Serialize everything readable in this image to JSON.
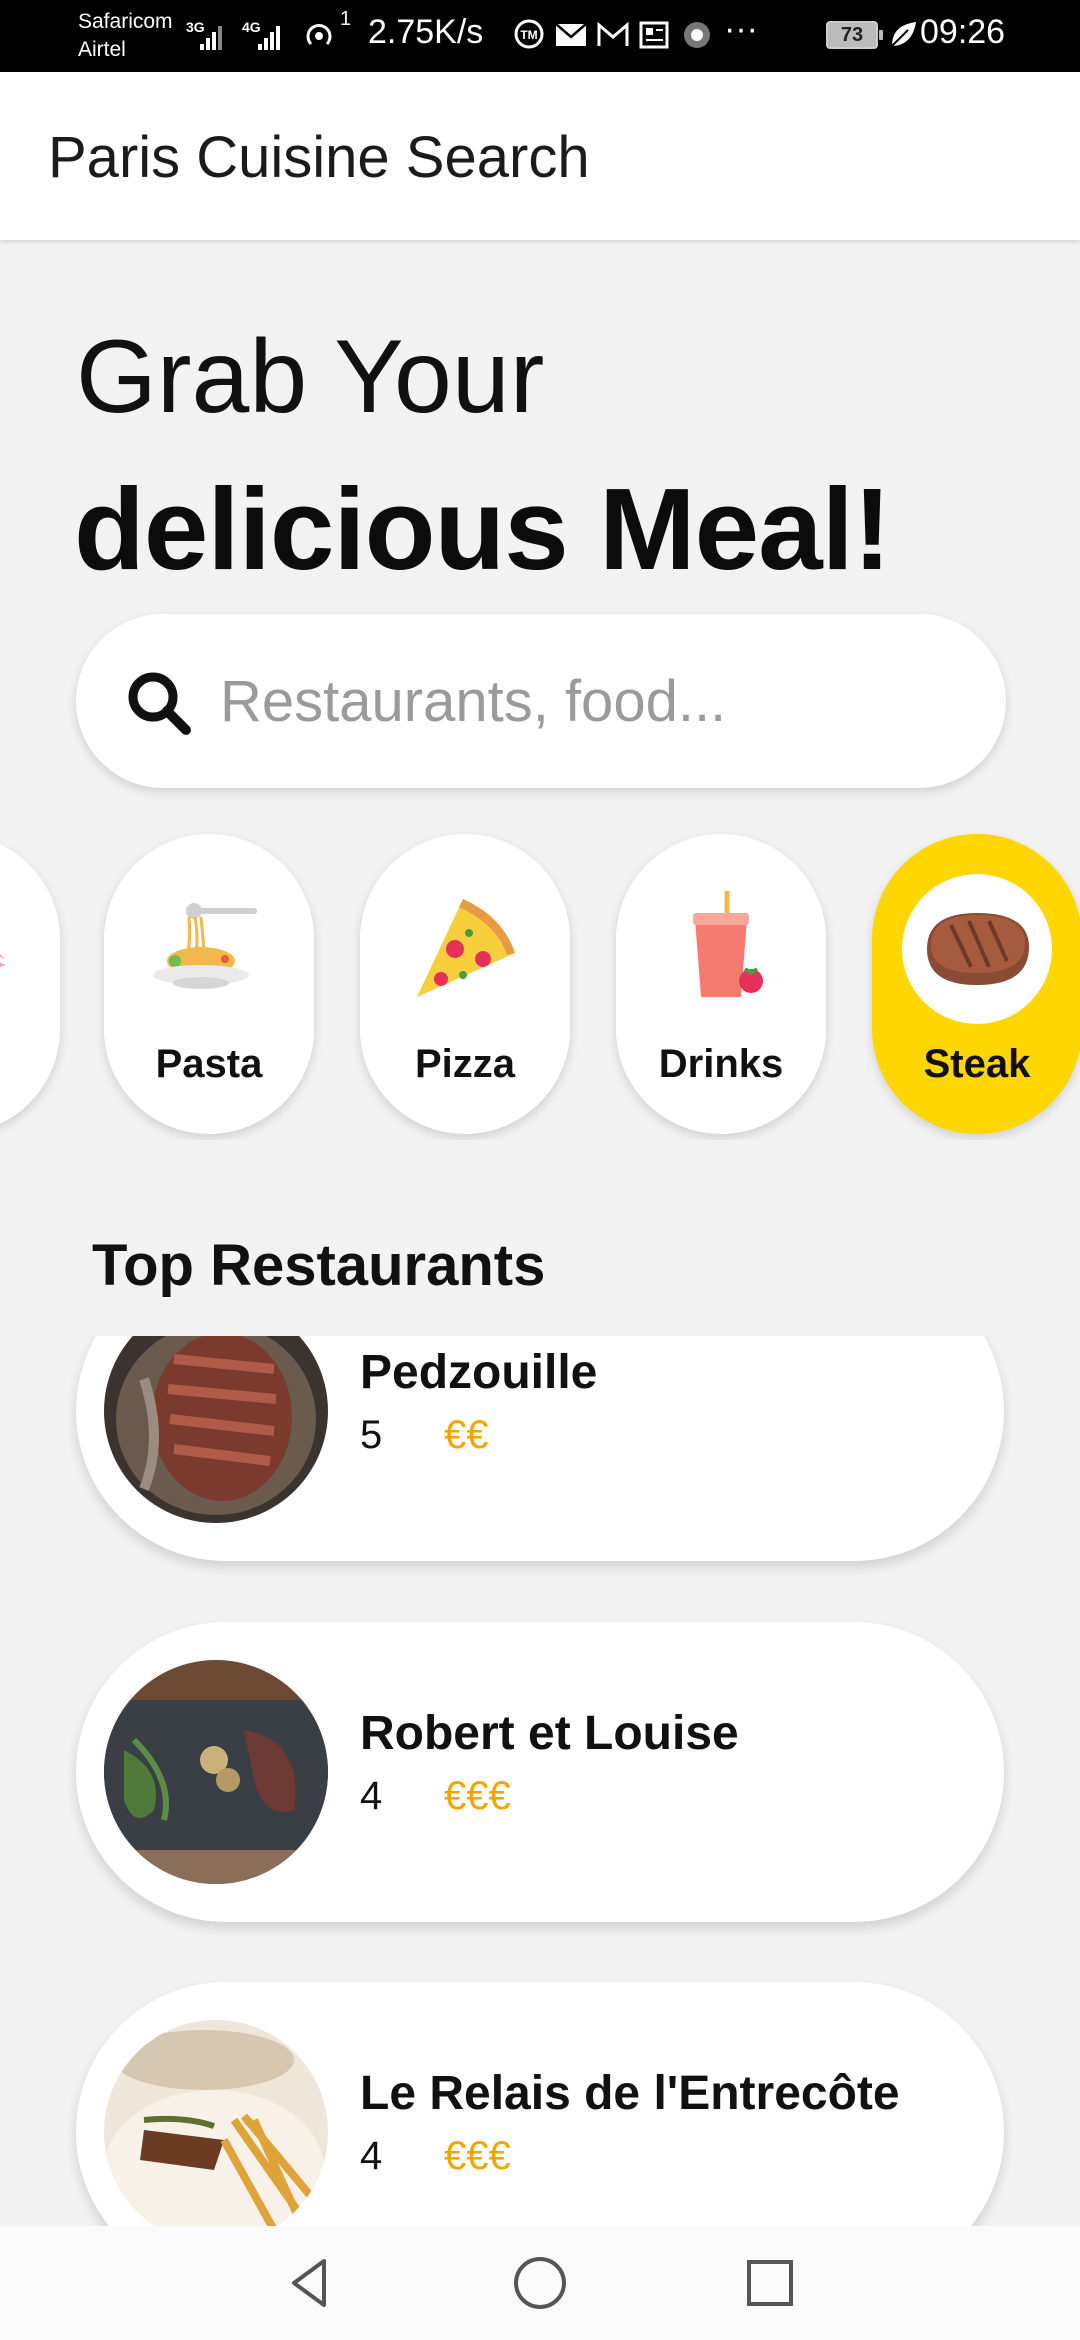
{
  "status_bar": {
    "carrier_1": "Safaricom",
    "carrier_2": "Airtel",
    "net_1": "3G",
    "net_2": "4G",
    "hotspot_count": "1",
    "speed": "2.75K/s",
    "more": "···",
    "battery": "73",
    "time": "09:26"
  },
  "app_bar": {
    "title": "Paris Cuisine Search"
  },
  "hero": {
    "line1": "Grab Your",
    "line2": "delicious Meal!"
  },
  "search": {
    "placeholder": "Restaurants, food...",
    "icon": "search-icon"
  },
  "categories": [
    {
      "label": "rt",
      "icon": "dessert-icon",
      "active": false
    },
    {
      "label": "Pasta",
      "icon": "pasta-icon",
      "active": false
    },
    {
      "label": "Pizza",
      "icon": "pizza-icon",
      "active": false
    },
    {
      "label": "Drinks",
      "icon": "drinks-icon",
      "active": false
    },
    {
      "label": "Steak",
      "icon": "steak-icon",
      "active": true
    }
  ],
  "section": {
    "title": "Top Restaurants"
  },
  "restaurants": [
    {
      "name": "Pedzouille",
      "rating": "5",
      "price": "€€"
    },
    {
      "name": "Robert et Louise",
      "rating": "4",
      "price": "€€€"
    },
    {
      "name": "Le Relais de l'Entrecôte",
      "rating": "4",
      "price": "€€€"
    }
  ],
  "colors": {
    "accent": "#ffd600",
    "price": "#f5a300",
    "background": "#f2f2f2"
  },
  "nav": {
    "back": "back-icon",
    "home": "home-icon",
    "recents": "recents-icon"
  }
}
